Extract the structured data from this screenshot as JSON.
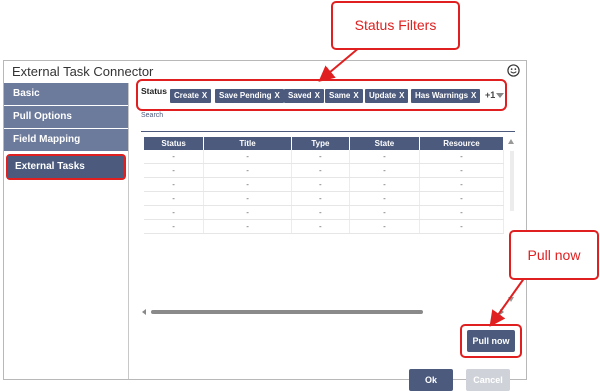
{
  "dialog": {
    "title": "External Task Connector",
    "smiley_icon": "smiley-icon"
  },
  "sidebar": {
    "items": [
      {
        "label": "Basic",
        "active": false
      },
      {
        "label": "Pull Options",
        "active": false
      },
      {
        "label": "Field Mapping",
        "active": false
      },
      {
        "label": "External Tasks",
        "active": true
      }
    ]
  },
  "filters": {
    "label": "Status",
    "chips": [
      {
        "label": "Create",
        "x": "X"
      },
      {
        "label": "Save Pending",
        "x": "X"
      },
      {
        "label": "Saved",
        "x": "X"
      },
      {
        "label": "Same",
        "x": "X"
      },
      {
        "label": "Update",
        "x": "X"
      },
      {
        "label": "Has Warnings",
        "x": "X"
      }
    ],
    "more": "+1",
    "search_label": "Search"
  },
  "table": {
    "columns": [
      "Status",
      "Title",
      "Type",
      "State",
      "Resource"
    ],
    "rows": [
      [
        "-",
        "-",
        "-",
        "-",
        "-"
      ],
      [
        "-",
        "-",
        "-",
        "-",
        "-"
      ],
      [
        "-",
        "-",
        "-",
        "-",
        "-"
      ],
      [
        "-",
        "-",
        "-",
        "-",
        "-"
      ],
      [
        "-",
        "-",
        "-",
        "-",
        "-"
      ],
      [
        "-",
        "-",
        "-",
        "-",
        "-"
      ]
    ]
  },
  "buttons": {
    "pull_now": "Pull now",
    "ok": "Ok",
    "cancel": "Cancel"
  },
  "callouts": {
    "status_filters": "Status Filters",
    "pull_now": "Pull now"
  },
  "colors": {
    "accent": "#4b5a7d",
    "sidebar": "#6c7a9c",
    "highlight": "#e02020",
    "disabled": "#cfd3d9"
  }
}
